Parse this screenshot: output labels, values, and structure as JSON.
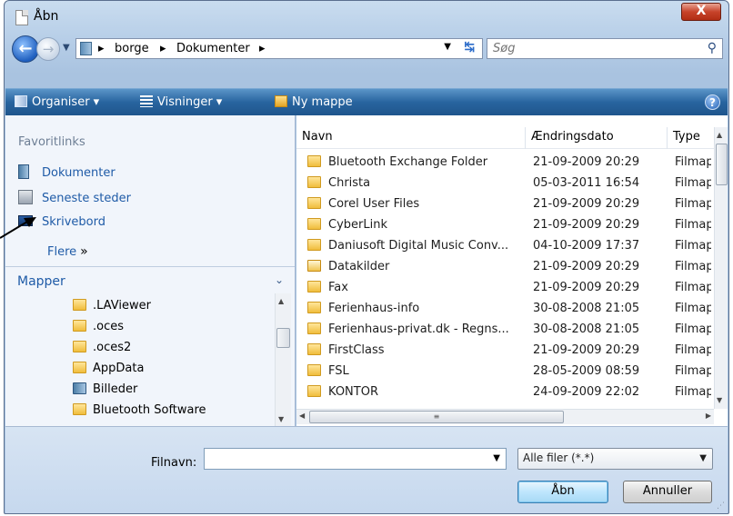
{
  "window": {
    "title": "Åbn",
    "close_label": "X"
  },
  "address": {
    "crumbs": [
      "borge",
      "Dokumenter"
    ],
    "search_placeholder": "Søg"
  },
  "toolbar": {
    "organize_label": "Organiser ▾",
    "views_label": "Visninger ▾",
    "new_folder_label": "Ny mappe",
    "help_label": "?"
  },
  "favorites": {
    "header": "Favoritlinks",
    "items": [
      {
        "label": "Dokumenter",
        "icon": "documents-icon"
      },
      {
        "label": "Seneste steder",
        "icon": "recent-places-icon"
      },
      {
        "label": "Skrivebord",
        "icon": "desktop-icon"
      }
    ],
    "more_label": "Flere",
    "more_chevron": "»"
  },
  "folders": {
    "header": "Mapper",
    "chevron": "⌄",
    "items": [
      {
        "label": ".LAViewer",
        "icon": "folder-icon"
      },
      {
        "label": ".oces",
        "icon": "folder-icon"
      },
      {
        "label": ".oces2",
        "icon": "folder-icon"
      },
      {
        "label": "AppData",
        "icon": "folder-icon"
      },
      {
        "label": "Billeder",
        "icon": "pictures-icon"
      },
      {
        "label": "Bluetooth Software",
        "icon": "folder-icon"
      }
    ]
  },
  "filelist": {
    "columns": {
      "name": "Navn",
      "date": "Ændringsdato",
      "type": "Type"
    },
    "rows": [
      {
        "name": "Bluetooth Exchange Folder",
        "date": "21-09-2009 20:29",
        "type": "Filmappe"
      },
      {
        "name": "Christa",
        "date": "05-03-2011 16:54",
        "type": "Filmappe"
      },
      {
        "name": "Corel User Files",
        "date": "21-09-2009 20:29",
        "type": "Filmappe"
      },
      {
        "name": "CyberLink",
        "date": "21-09-2009 20:29",
        "type": "Filmappe"
      },
      {
        "name": "Daniusoft Digital Music Conv...",
        "date": "04-10-2009 17:37",
        "type": "Filmappe"
      },
      {
        "name": "Datakilder",
        "date": "21-09-2009 20:29",
        "type": "Filmappe"
      },
      {
        "name": "Fax",
        "date": "21-09-2009 20:29",
        "type": "Filmappe"
      },
      {
        "name": "Ferienhaus-info",
        "date": "30-08-2008 21:05",
        "type": "Filmappe"
      },
      {
        "name": "Ferienhaus-privat.dk - Regns...",
        "date": "30-08-2008 21:05",
        "type": "Filmappe"
      },
      {
        "name": "FirstClass",
        "date": "21-09-2009 20:29",
        "type": "Filmappe"
      },
      {
        "name": "FSL",
        "date": "28-05-2009 08:59",
        "type": "Filmappe"
      },
      {
        "name": "KONTOR",
        "date": "24-09-2009 22:02",
        "type": "Filmappe"
      }
    ]
  },
  "footer": {
    "filename_label": "Filnavn:",
    "filename_value": "",
    "filetype_value": "Alle filer (*.*)",
    "open_label": "Åbn",
    "cancel_label": "Annuller"
  }
}
